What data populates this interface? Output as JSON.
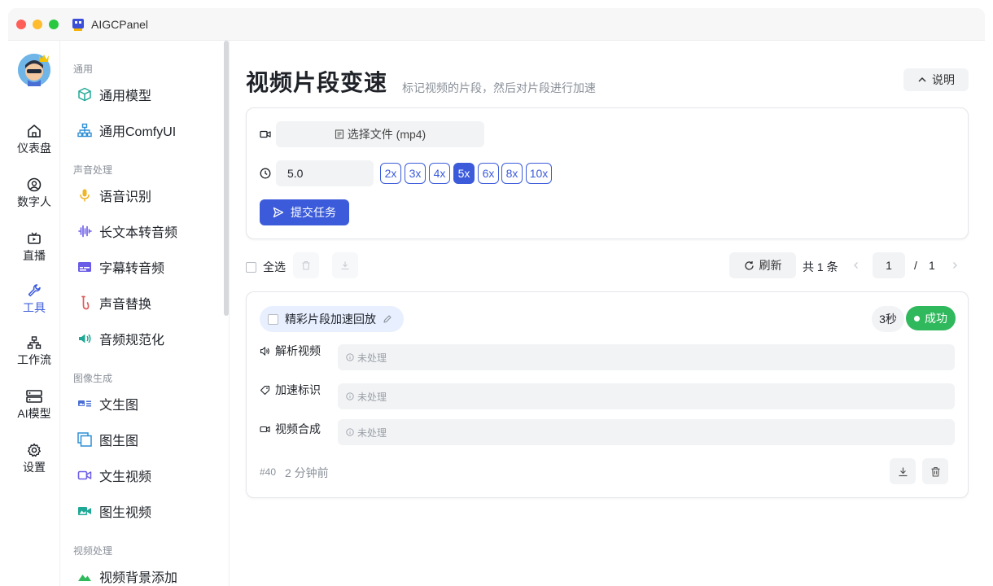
{
  "app": {
    "title": "AIGCPanel"
  },
  "rail": {
    "items": [
      {
        "label": "仪表盘",
        "icon": "home-icon"
      },
      {
        "label": "数字人",
        "icon": "user-circle-icon"
      },
      {
        "label": "直播",
        "icon": "tv-icon"
      },
      {
        "label": "工具",
        "icon": "wrench-icon",
        "active": true
      },
      {
        "label": "工作流",
        "icon": "sitemap-icon"
      },
      {
        "label": "AI模型",
        "icon": "server-icon"
      },
      {
        "label": "设置",
        "icon": "gear-icon"
      }
    ]
  },
  "subnav": {
    "groups": [
      {
        "label": "通用",
        "items": [
          {
            "label": "通用模型",
            "icon": "cube-icon"
          },
          {
            "label": "通用ComfyUI",
            "icon": "sitemap-icon"
          }
        ]
      },
      {
        "label": "声音处理",
        "items": [
          {
            "label": "语音识别",
            "icon": "microphone-icon"
          },
          {
            "label": "长文本转音频",
            "icon": "waveform-icon"
          },
          {
            "label": "字幕转音频",
            "icon": "subtitles-icon"
          },
          {
            "label": "声音替换",
            "icon": "saxophone-icon"
          },
          {
            "label": "音频规范化",
            "icon": "speaker-icon"
          }
        ]
      },
      {
        "label": "图像生成",
        "items": [
          {
            "label": "文生图",
            "icon": "text-image-icon"
          },
          {
            "label": "图生图",
            "icon": "image-stack-icon"
          },
          {
            "label": "文生视频",
            "icon": "video-camera-icon"
          },
          {
            "label": "图生视频",
            "icon": "image-video-icon"
          }
        ]
      },
      {
        "label": "视频处理",
        "items": [
          {
            "label": "视频背景添加",
            "icon": "mountain-icon"
          }
        ]
      }
    ]
  },
  "page": {
    "title": "视频片段变速",
    "subtitle": "标记视频的片段，然后对片段进行加速",
    "help_label": "说明"
  },
  "form": {
    "file_button": "选择文件 (mp4)",
    "speed_value": "5.0",
    "speed_options": [
      "2x",
      "3x",
      "4x",
      "5x",
      "6x",
      "8x",
      "10x"
    ],
    "speed_selected": "5x",
    "submit_label": "提交任务"
  },
  "toolbar": {
    "select_all": "全选",
    "refresh": "刷新",
    "total": "共 1 条",
    "page": "1",
    "page_sep": "/",
    "page_total": "1"
  },
  "task": {
    "name": "精彩片段加速回放",
    "duration": "3秒",
    "status": "成功",
    "steps": [
      {
        "label": "解析视频",
        "icon": "volume-icon",
        "status": "未处理"
      },
      {
        "label": "加速标识",
        "icon": "tag-icon",
        "status": "未处理"
      },
      {
        "label": "视频合成",
        "icon": "video-camera-icon",
        "status": "未处理"
      }
    ],
    "id": "#40",
    "time": "2 分钟前"
  },
  "colors": {
    "primary": "#3b5bdb",
    "success": "#2fb85c",
    "muted": "#8a9099"
  }
}
